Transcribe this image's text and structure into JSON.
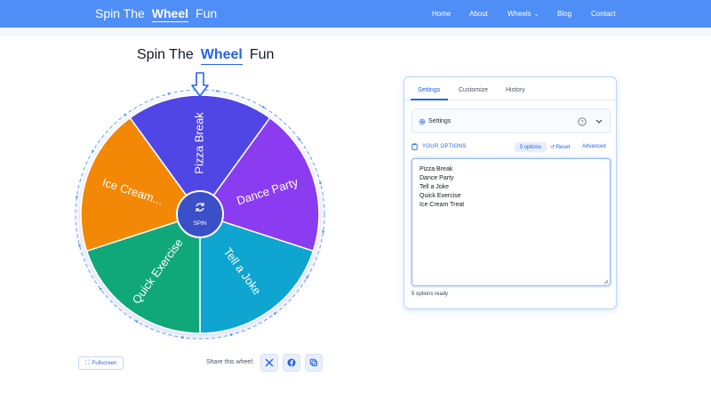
{
  "brand": {
    "left": "Spin The",
    "middle": "Wheel",
    "right": "Fun"
  },
  "nav": {
    "home": "Home",
    "about": "About",
    "wheels": "Wheels",
    "blog": "Blog",
    "contact": "Contact"
  },
  "page_title": {
    "left": "Spin The",
    "middle": "Wheel",
    "right": "Fun"
  },
  "wheel": {
    "spin_label": "SPIN",
    "segments": [
      {
        "label": "Pizza Break",
        "color": "#4f46e5"
      },
      {
        "label": "Dance Party",
        "color": "#8b3cf0"
      },
      {
        "label": "Tell a Joke",
        "color": "#0ea5d0"
      },
      {
        "label": "Quick Exercise",
        "color": "#10a878"
      },
      {
        "label": "Ice Cream...",
        "color": "#f38807"
      }
    ],
    "hub_color": "#3b4fc9",
    "pointer_color": "#2563eb",
    "ring_color": "#6fa3ea"
  },
  "controls": {
    "fullscreen_label": "Fullscreen",
    "share_label": "Share this wheel:"
  },
  "panel": {
    "tabs": {
      "settings": "Settings",
      "customize": "Customize",
      "history": "History"
    },
    "settings_row_label": "Settings",
    "options_title": "YOUR OPTIONS",
    "options_badge": "5 options",
    "reset_label": "Reset",
    "advanced_label": "Advanced",
    "options_text": "Pizza Break\nDance Party\nTell a Joke\nQuick Exercise\nIce Cream Treat",
    "status": "5 options ready"
  },
  "colors": {
    "accent": "#2563eb",
    "header": "#4f8ef7"
  }
}
